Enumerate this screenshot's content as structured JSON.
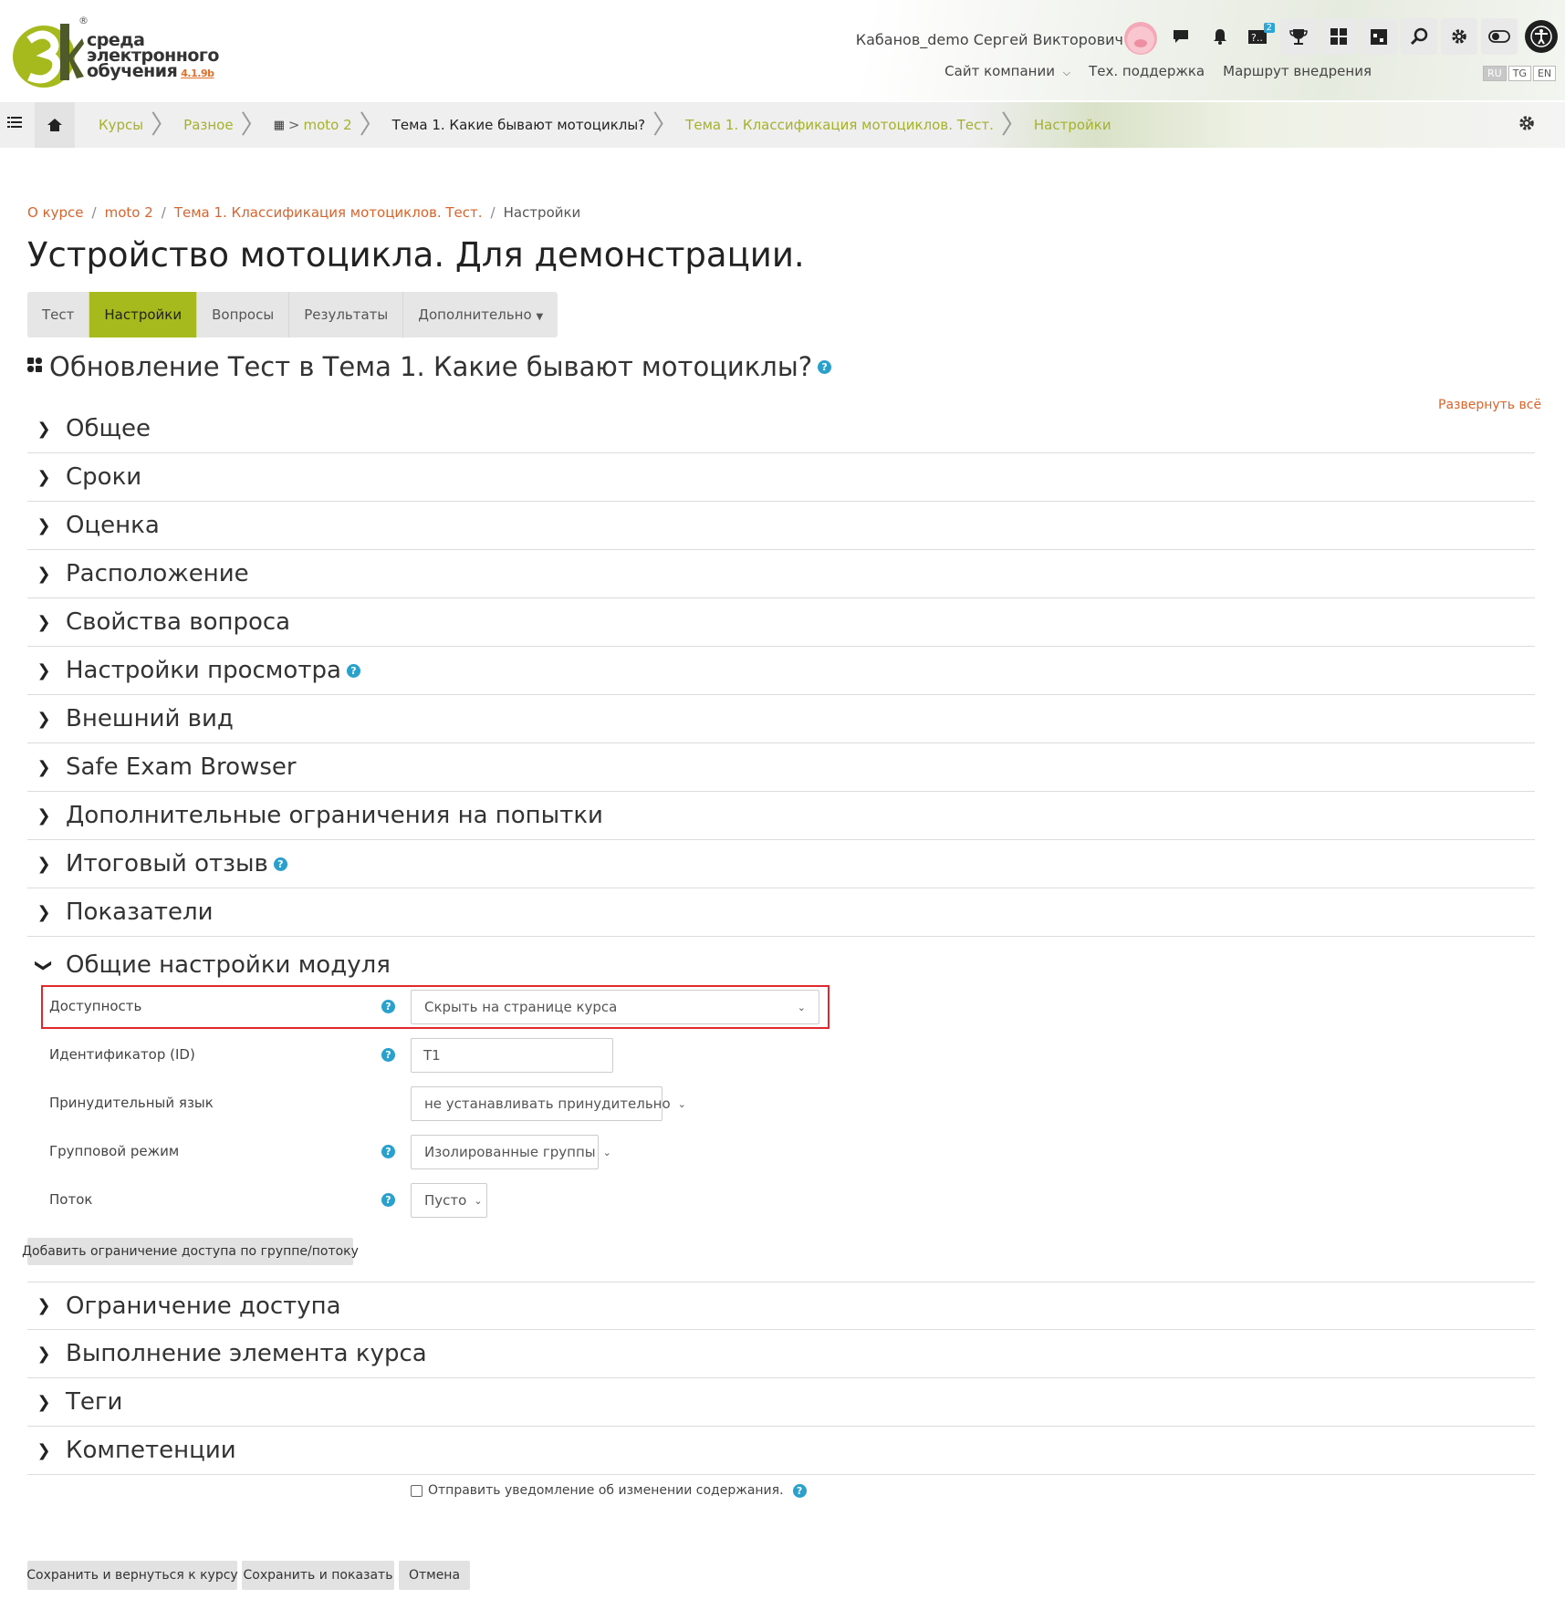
{
  "header": {
    "logo_line1": "среда",
    "logo_line2": "электронного",
    "logo_line3": "обучения",
    "logo_version": "4.1.9b",
    "user_name": "Кабанов_demo Сергей Викторович",
    "messages_badge": "2",
    "links": [
      "Сайт компании",
      "Тех. поддержка",
      "Маршрут внедрения"
    ],
    "languages": [
      "RU",
      "TG",
      "EN"
    ]
  },
  "navbar": {
    "crumbs": [
      "Курсы",
      "Разное",
      "moto 2",
      "Тема 1. Какие бывают мотоциклы?",
      "Тема 1. Классификация мотоциклов. Тест.",
      "Настройки"
    ]
  },
  "breadcrumb": {
    "items": [
      "О курсе",
      "moto 2",
      "Тема 1. Классификация мотоциклов. Тест.",
      "Настройки"
    ]
  },
  "page": {
    "title": "Устройство мотоцикла. Для демонстрации.",
    "tabs": [
      "Тест",
      "Настройки",
      "Вопросы",
      "Результаты",
      "Дополнительно"
    ],
    "active_tab": "Настройки",
    "section_title": "Обновление Тест в Тема 1. Какие бывают мотоциклы?",
    "expand_all": "Развернуть всё"
  },
  "sections_top": [
    "Общее",
    "Сроки",
    "Оценка",
    "Расположение",
    "Свойства вопроса",
    "Настройки просмотра",
    "Внешний вид",
    "Safe Exam Browser",
    "Дополнительные ограничения на попытки",
    "Итоговый отзыв",
    "Показатели"
  ],
  "module_settings": {
    "title": "Общие настройки модуля",
    "availability_label": "Доступность",
    "availability_value": "Скрыть на странице курса",
    "idnumber_label": "Идентификатор (ID)",
    "idnumber_value": "T1",
    "lang_label": "Принудительный язык",
    "lang_value": "не устанавливать принудительно",
    "groupmode_label": "Групповой режим",
    "groupmode_value": "Изолированные группы",
    "grouping_label": "Поток",
    "grouping_value": "Пусто",
    "add_restriction_button": "Добавить ограничение доступа по группе/потоку"
  },
  "sections_bottom": [
    "Ограничение доступа",
    "Выполнение элемента курса",
    "Теги",
    "Компетенции"
  ],
  "notify_label": "Отправить уведомление об изменении содержания.",
  "buttons": {
    "save_return": "Сохранить и вернуться к курсу",
    "save_display": "Сохранить и показать",
    "cancel": "Отмена"
  },
  "colors": {
    "accent": "#a6ba1d",
    "link": "#d9642c",
    "help": "#2aa0cc",
    "highlight": "#e0282f"
  }
}
